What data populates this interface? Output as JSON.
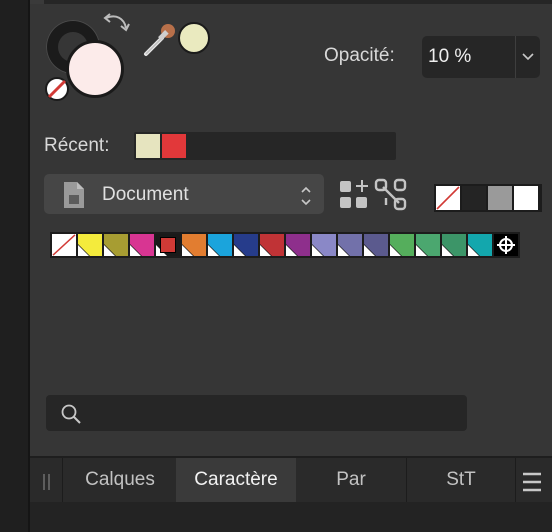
{
  "colour_panel": {
    "fill_color": "#fcebea",
    "stroke_color": "#1b1b1b",
    "picked_color": "#eaeabf"
  },
  "opacity": {
    "label": "Opacité:",
    "value": "10 %"
  },
  "recent": {
    "label": "Récent:",
    "colors": [
      "#e6e4bf",
      "#e2383a"
    ]
  },
  "palette": {
    "selected": "Document"
  },
  "quick_swatches": [
    "none",
    "#242424",
    "#9a9a9a",
    "#ffffff"
  ],
  "swatches": [
    {
      "color": "none"
    },
    {
      "color": "#f4eb3c"
    },
    {
      "color": "#a79d32"
    },
    {
      "color": "#d83592"
    },
    {
      "color": "#d03a36",
      "selected": true
    },
    {
      "color": "#e27d30"
    },
    {
      "color": "#1ba4dc"
    },
    {
      "color": "#263c8b"
    },
    {
      "color": "#c03336"
    },
    {
      "color": "#8e2f8c"
    },
    {
      "color": "#8a88c7"
    },
    {
      "color": "#7271aa"
    },
    {
      "color": "#5b5a8e"
    },
    {
      "color": "#55ae5c"
    },
    {
      "color": "#4ba76f"
    },
    {
      "color": "#3c9568"
    },
    {
      "color": "#13a7ad"
    },
    {
      "color": "#000000",
      "icon": "crosshair-icon"
    }
  ],
  "search": {
    "placeholder": ""
  },
  "tabs": [
    {
      "label": "Calques",
      "active": false
    },
    {
      "label": "Caractère",
      "active": true
    },
    {
      "label": "Par",
      "active": false
    },
    {
      "label": "StT",
      "active": false
    }
  ]
}
